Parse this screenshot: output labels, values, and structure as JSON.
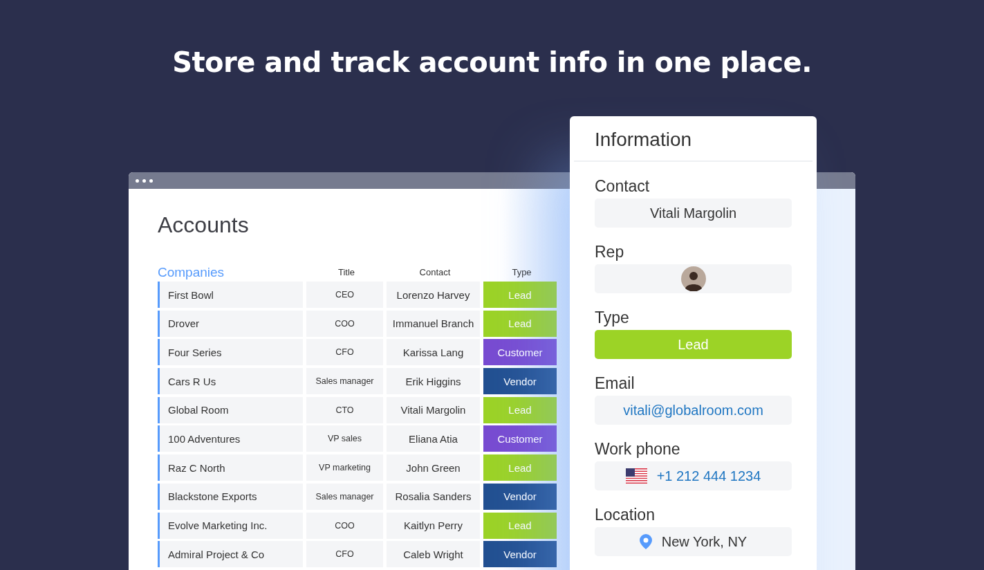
{
  "headline": "Store and track account info in one place.",
  "window": {
    "title": "Accounts"
  },
  "table": {
    "group": "Companies",
    "columns": [
      "Title",
      "Contact",
      "Type"
    ],
    "rows": [
      {
        "company": "First Bowl",
        "title": "CEO",
        "contact": "Lorenzo Harvey",
        "type": "Lead",
        "color": "#9cd326"
      },
      {
        "company": "Drover",
        "title": "COO",
        "contact": "Immanuel Branch",
        "type": "Lead",
        "color": "#9cd326"
      },
      {
        "company": "Four Series",
        "title": "CFO",
        "contact": "Karissa Lang",
        "type": "Customer",
        "color": "#784bd1"
      },
      {
        "company": "Cars R Us",
        "title": "Sales manager",
        "contact": "Erik Higgins",
        "type": "Vendor",
        "color": "#225091"
      },
      {
        "company": "Global Room",
        "title": "CTO",
        "contact": "Vitali Margolin",
        "type": "Lead",
        "color": "#9cd326"
      },
      {
        "company": "100 Adventures",
        "title": "VP sales",
        "contact": "Eliana Atia",
        "type": "Customer",
        "color": "#784bd1"
      },
      {
        "company": "Raz C North",
        "title": "VP marketing",
        "contact": "John Green",
        "type": "Lead",
        "color": "#9cd326"
      },
      {
        "company": "Blackstone Exports",
        "title": "Sales manager",
        "contact": "Rosalia Sanders",
        "type": "Vendor",
        "color": "#225091"
      },
      {
        "company": "Evolve Marketing Inc.",
        "title": "COO",
        "contact": "Kaitlyn Perry",
        "type": "Lead",
        "color": "#9cd326"
      },
      {
        "company": "Admiral Project & Co",
        "title": "CFO",
        "contact": "Caleb Wright",
        "type": "Vendor",
        "color": "#225091"
      }
    ]
  },
  "information": {
    "title": "Information",
    "fields": [
      {
        "kind": "text",
        "label": "Contact",
        "value": "Vitali Margolin"
      },
      {
        "kind": "avatar",
        "label": "Rep"
      },
      {
        "kind": "status",
        "label": "Type",
        "value": "Lead",
        "color": "#9cd326"
      },
      {
        "kind": "link",
        "label": "Email",
        "value": "vitali@globalroom.com"
      },
      {
        "kind": "phone",
        "label": "Work phone",
        "value": "+1 212 444 1234"
      },
      {
        "kind": "location",
        "label": "Location",
        "value": "New York, NY"
      }
    ]
  }
}
